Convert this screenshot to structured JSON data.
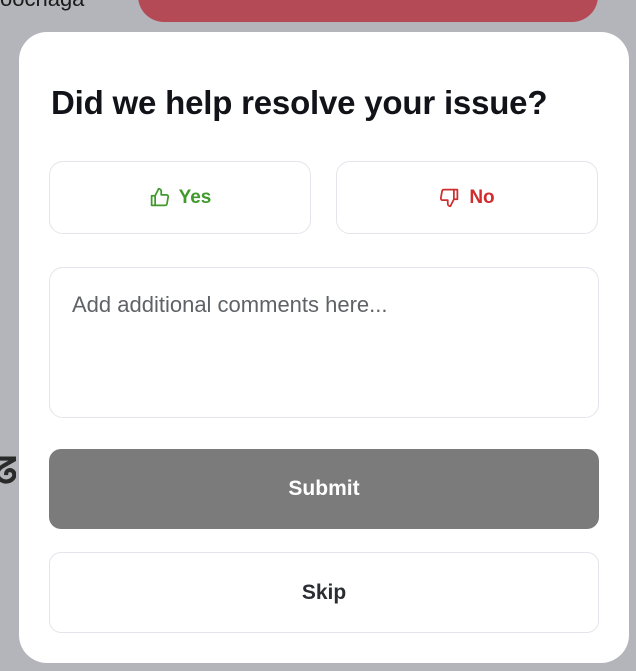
{
  "backdrop": {
    "partial_text": "oochaga",
    "glyph_text": "ᘔ"
  },
  "feedback_modal": {
    "title": "Did we help resolve your issue?",
    "yes_button": {
      "label": "Yes",
      "icon": "thumbs-up-icon",
      "color": "#3f9a2a"
    },
    "no_button": {
      "label": "No",
      "icon": "thumbs-down-icon",
      "color": "#cf2e2e"
    },
    "comments": {
      "value": "",
      "placeholder": "Add additional comments here..."
    },
    "submit_button": {
      "label": "Submit",
      "background": "#7b7b7b"
    },
    "skip_button": {
      "label": "Skip"
    }
  }
}
